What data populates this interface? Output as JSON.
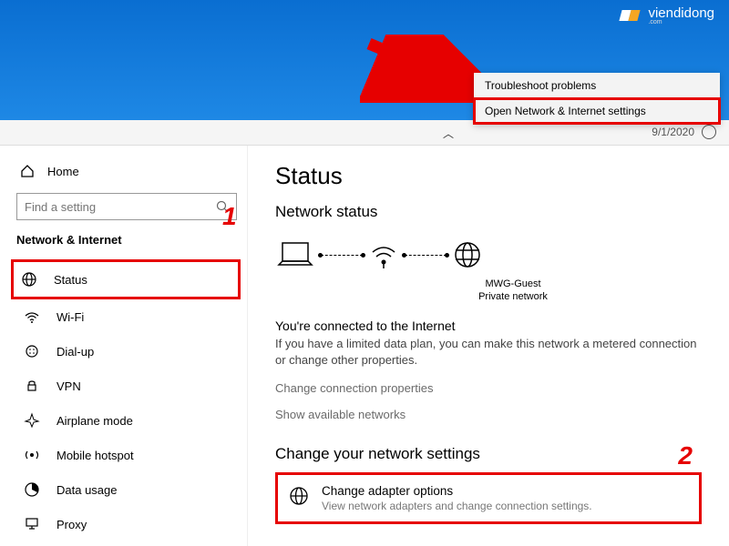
{
  "logo": {
    "text": "viendidong",
    "sub": ".com"
  },
  "context_menu": {
    "items": [
      "Troubleshoot problems",
      "Open Network & Internet settings"
    ]
  },
  "topbar": {
    "date": "9/1/2020"
  },
  "sidebar": {
    "home": "Home",
    "search_placeholder": "Find a setting",
    "section": "Network & Internet",
    "items": [
      {
        "label": "Status"
      },
      {
        "label": "Wi-Fi"
      },
      {
        "label": "Dial-up"
      },
      {
        "label": "VPN"
      },
      {
        "label": "Airplane mode"
      },
      {
        "label": "Mobile hotspot"
      },
      {
        "label": "Data usage"
      },
      {
        "label": "Proxy"
      }
    ]
  },
  "content": {
    "title": "Status",
    "subtitle": "Network status",
    "network_name": "MWG-Guest",
    "network_type": "Private network",
    "connected_heading": "You're connected to the Internet",
    "connected_body": "If you have a limited data plan, you can make this network a metered connection or change other properties.",
    "link1": "Change connection properties",
    "link2": "Show available networks",
    "change_heading": "Change your network settings",
    "option": {
      "title": "Change adapter options",
      "sub": "View network adapters and change connection settings."
    }
  },
  "annotations": {
    "one": "1",
    "two": "2"
  }
}
